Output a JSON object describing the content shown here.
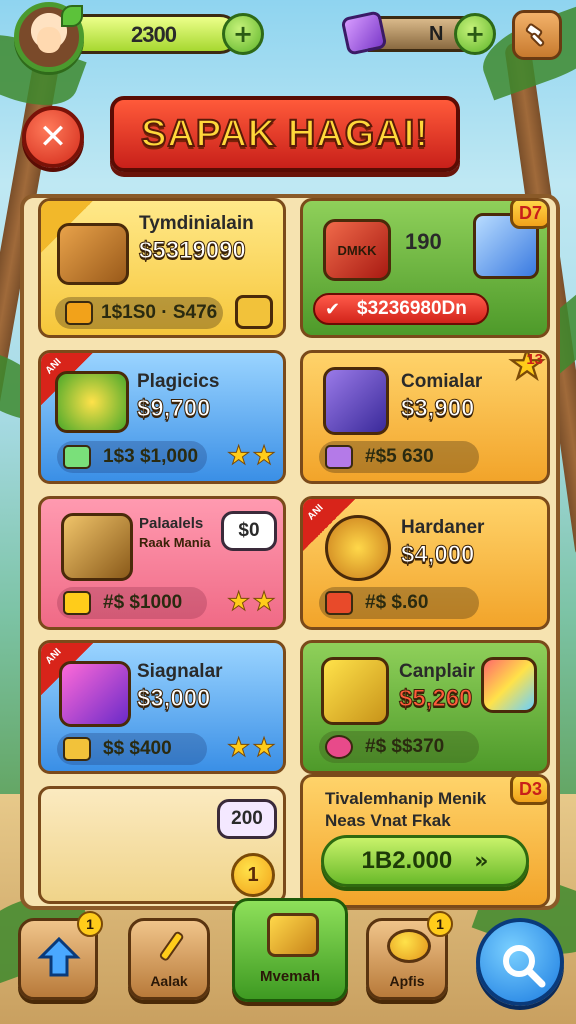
{
  "header": {
    "coins": "2300",
    "gems": "N",
    "coin_plus_label": "+",
    "gem_plus_label": "+"
  },
  "title": {
    "text": "SAPAK HAGAI!",
    "close_label": "✕"
  },
  "cards": [
    {
      "name": "Tymdinialain",
      "price": "$5319090",
      "pill": "1$1S0 · S476",
      "color": "yellow",
      "corner": ""
    },
    {
      "name": "",
      "price": "190",
      "pill": "$3236980Dn",
      "badge": "D7",
      "color": "green",
      "box_label": "DMKK"
    },
    {
      "name": "Plagicics",
      "price": "$9,700",
      "pill": "1$3 $1,000",
      "color": "blue",
      "corner": "ANI"
    },
    {
      "name": "Comialar",
      "price": "$3,900",
      "pill": "#$5 630",
      "badge": "13",
      "color": "orange"
    },
    {
      "name": "Palaalels",
      "sub": "Raak Mania",
      "price": "",
      "pill": "#$ $1000",
      "speech": "$0",
      "color": "pink"
    },
    {
      "name": "Hardaner",
      "price": "$4,000",
      "pill": "#$ $.60",
      "color": "orange",
      "corner": "ANI"
    },
    {
      "name": "Siagnalar",
      "price": "$3,000",
      "pill": "$$ $400",
      "color": "blue",
      "corner": "ANI"
    },
    {
      "name": "Canplair",
      "price": "$5,260",
      "pill": "#$ $$370",
      "color": "green"
    },
    {
      "name": "",
      "price": "",
      "speech": "200",
      "coin": "1",
      "color": "cream"
    },
    {
      "name": "Tivalemhanip Menik",
      "sub": "Neas Vnat Fkak",
      "button": "1B2.000",
      "badge": "D3",
      "color": "orange"
    }
  ],
  "nav": [
    {
      "label": "",
      "badge": "1"
    },
    {
      "label": "Aalak",
      "badge": ""
    },
    {
      "label": "Mvemah",
      "badge": ""
    },
    {
      "label": "Apfis",
      "badge": "1"
    }
  ],
  "colors": {
    "accent_red": "#d22a1a",
    "accent_green": "#6aba2a",
    "accent_gold": "#ffcc1a",
    "panel": "#f6e3b0"
  }
}
